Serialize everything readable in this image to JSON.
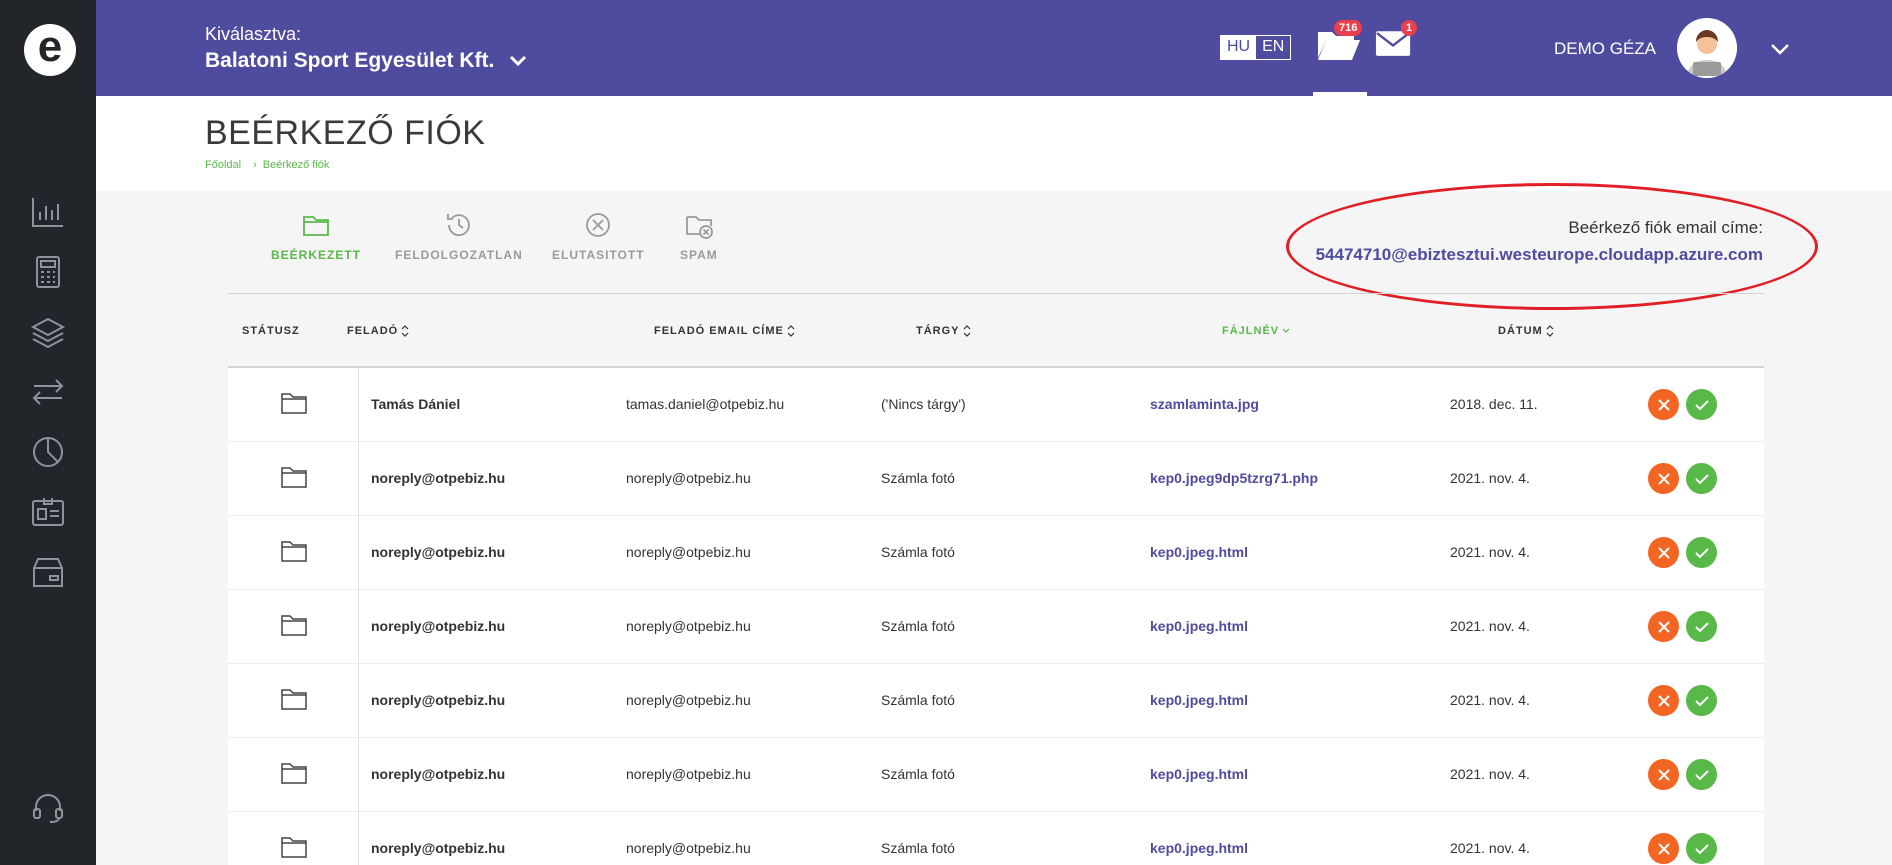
{
  "topbar": {
    "selected_label": "Kiválasztva:",
    "company_name": "Balatoni Sport Egyesület Kft.",
    "lang_hu": "HU",
    "lang_en": "EN",
    "folder_badge": "716",
    "mail_badge": "1",
    "username": "DEMO GÉZA"
  },
  "page": {
    "title": "BEÉRKEZŐ FIÓK",
    "breadcrumb_home": "Főoldal",
    "breadcrumb_current": "Beérkező fiók"
  },
  "tabs": [
    {
      "label": "BEÉRKEZETT",
      "icon": "folder-icon",
      "active": true
    },
    {
      "label": "FELDOLGOZATLAN",
      "icon": "history-icon",
      "active": false
    },
    {
      "label": "ELUTASITOTT",
      "icon": "x-circle-icon",
      "active": false
    },
    {
      "label": "SPAM",
      "icon": "folder-x-icon",
      "active": false
    }
  ],
  "inbox_email": {
    "label": "Beérkező fiók email címe:",
    "value": "54474710@ebiztesztui.westeurope.cloudapp.azure.com"
  },
  "table": {
    "headers": {
      "status": "STÁTUSZ",
      "sender": "FELADÓ",
      "sender_email": "FELADÓ EMAIL CÍME",
      "subject": "TÁRGY",
      "filename": "FÁJLNÉV",
      "date": "DÁTUM"
    },
    "rows": [
      {
        "sender": "Tamás Dániel",
        "email": "tamas.daniel@otpebiz.hu",
        "subject": "('Nincs tárgy')",
        "file": "szamlaminta.jpg",
        "date": "2018. dec. 11."
      },
      {
        "sender": "noreply@otpebiz.hu",
        "email": "noreply@otpebiz.hu",
        "subject": "Számla fotó",
        "file": "kep0.jpeg9dp5tzrg71.php",
        "date": "2021. nov. 4."
      },
      {
        "sender": "noreply@otpebiz.hu",
        "email": "noreply@otpebiz.hu",
        "subject": "Számla fotó",
        "file": "kep0.jpeg.html",
        "date": "2021. nov. 4."
      },
      {
        "sender": "noreply@otpebiz.hu",
        "email": "noreply@otpebiz.hu",
        "subject": "Számla fotó",
        "file": "kep0.jpeg.html",
        "date": "2021. nov. 4."
      },
      {
        "sender": "noreply@otpebiz.hu",
        "email": "noreply@otpebiz.hu",
        "subject": "Számla fotó",
        "file": "kep0.jpeg.html",
        "date": "2021. nov. 4."
      },
      {
        "sender": "noreply@otpebiz.hu",
        "email": "noreply@otpebiz.hu",
        "subject": "Számla fotó",
        "file": "kep0.jpeg.html",
        "date": "2021. nov. 4."
      },
      {
        "sender": "noreply@otpebiz.hu",
        "email": "noreply@otpebiz.hu",
        "subject": "Számla fotó",
        "file": "kep0.jpeg.html",
        "date": "2021. nov. 4."
      }
    ]
  },
  "colors": {
    "brand": "#4f4ca0",
    "sidebar": "#22262b",
    "accent_green": "#58b848",
    "reject_orange": "#f26522",
    "highlight_red": "#e01f26"
  }
}
